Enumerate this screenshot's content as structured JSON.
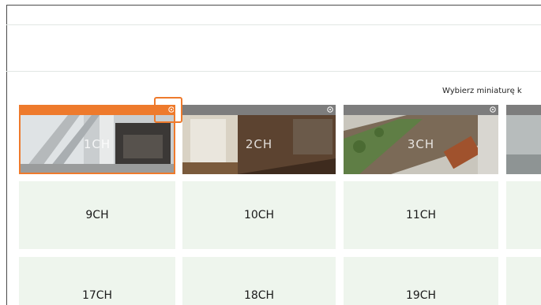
{
  "hint_text": "Wybierz miniaturę k",
  "thumbnails": [
    {
      "label": "1CH",
      "active": true
    },
    {
      "label": "2CH",
      "active": false
    },
    {
      "label": "3CH",
      "active": false
    }
  ],
  "rows": [
    [
      "9CH",
      "10CH",
      "11CH"
    ],
    [
      "17CH",
      "18CH",
      "19CH"
    ]
  ],
  "colors": {
    "active_bar": "#ee7a2c",
    "inactive_bar": "#7d7d7d",
    "cell_bg": "#eef5ed",
    "frame_line": "#4a4a4a"
  }
}
